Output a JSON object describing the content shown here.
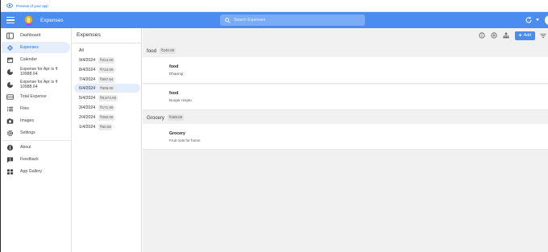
{
  "preview_bar": {
    "text": "Preview of your app"
  },
  "app": {
    "title": "Expenses"
  },
  "search": {
    "placeholder": "Search Expenses"
  },
  "colors": {
    "accent": "#4a8cf0",
    "active_bg": "#e6eefb",
    "active_text": "#1a73e8"
  },
  "sidebar": {
    "items": [
      {
        "label": "Dashboard",
        "icon": "dashboard-icon"
      },
      {
        "label": "Expenses",
        "icon": "expenses-icon",
        "active": true
      },
      {
        "label": "Calender",
        "icon": "calendar-icon"
      },
      {
        "label": "Expense for Apr is ₹ 10988.64",
        "icon": "pie-chart-icon"
      },
      {
        "label": "Expense for Apr is ₹ 10988.64",
        "icon": "pie-chart-icon"
      },
      {
        "label": "Total Expense",
        "icon": "table-icon"
      },
      {
        "label": "Files",
        "icon": "list-icon"
      },
      {
        "label": "Images",
        "icon": "camera-icon"
      },
      {
        "label": "Settings",
        "icon": "gear-icon"
      },
      {
        "label": "About",
        "icon": "info-icon"
      },
      {
        "label": "Feedback",
        "icon": "feedback-icon"
      },
      {
        "label": "App Gallery",
        "icon": "grid-icon"
      }
    ]
  },
  "list": {
    "title": "Expenses",
    "all_label": "All",
    "dates": [
      {
        "date": "9/4/2024",
        "amount": "₹214.00"
      },
      {
        "date": "8/4/2024",
        "amount": "₹724.00"
      },
      {
        "date": "7/4/2024",
        "amount": "₹697.64"
      },
      {
        "date": "6/4/2024",
        "amount": "₹509.00",
        "active": true
      },
      {
        "date": "5/4/2024",
        "amount": "₹8,573.00"
      },
      {
        "date": "3/4/2024",
        "amount": "₹171.00"
      },
      {
        "date": "2/4/2024",
        "amount": "₹250.00"
      },
      {
        "date": "1/4/2024",
        "amount": "₹50.00"
      }
    ]
  },
  "toolbar": {
    "add_label": "Add"
  },
  "groups": [
    {
      "name": "food",
      "total": "₹240.00",
      "items": [
        {
          "title": "food",
          "subtitle": "Dhaaruji"
        },
        {
          "title": "food",
          "subtitle": "Burger respto"
        }
      ]
    },
    {
      "name": "Grocery",
      "total": "₹269.00",
      "items": [
        {
          "title": "Grocery",
          "subtitle": "Fruit nuts for home"
        }
      ]
    }
  ]
}
